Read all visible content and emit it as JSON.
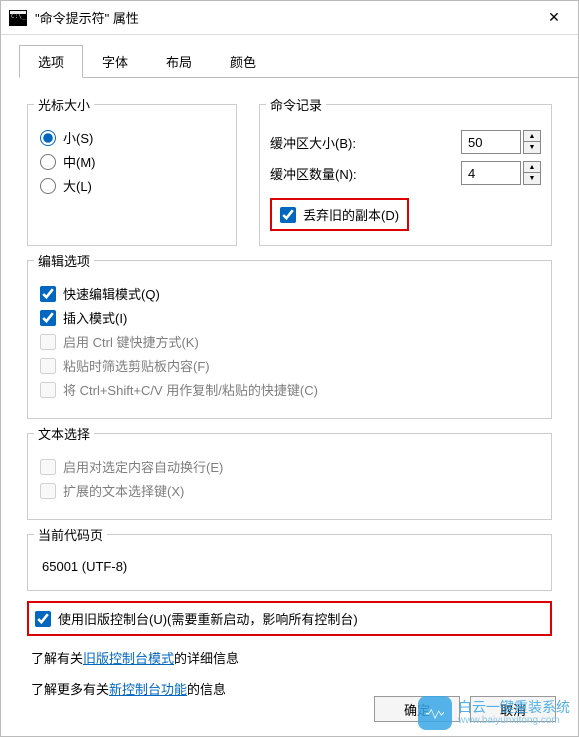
{
  "window": {
    "title": "\"命令提示符\" 属性"
  },
  "tabs": [
    "选项",
    "字体",
    "布局",
    "颜色"
  ],
  "active_tab_index": 0,
  "cursor_size": {
    "legend": "光标大小",
    "options": [
      "小(S)",
      "中(M)",
      "大(L)"
    ],
    "selected_index": 0
  },
  "command_history": {
    "legend": "命令记录",
    "buffer_size_label": "缓冲区大小(B):",
    "buffer_size_value": "50",
    "buffer_count_label": "缓冲区数量(N):",
    "buffer_count_value": "4",
    "discard_old_label": "丢弃旧的副本(D)",
    "discard_old_checked": true
  },
  "edit_options": {
    "legend": "编辑选项",
    "items": [
      {
        "label": "快速编辑模式(Q)",
        "checked": true,
        "enabled": true
      },
      {
        "label": "插入模式(I)",
        "checked": true,
        "enabled": true
      },
      {
        "label": "启用 Ctrl 键快捷方式(K)",
        "checked": false,
        "enabled": false
      },
      {
        "label": "粘贴时筛选剪贴板内容(F)",
        "checked": false,
        "enabled": false
      },
      {
        "label": "将 Ctrl+Shift+C/V 用作复制/粘贴的快捷键(C)",
        "checked": false,
        "enabled": false
      }
    ]
  },
  "text_selection": {
    "legend": "文本选择",
    "items": [
      {
        "label": "启用对选定内容自动换行(E)",
        "checked": false,
        "enabled": false
      },
      {
        "label": "扩展的文本选择键(X)",
        "checked": false,
        "enabled": false
      }
    ]
  },
  "code_page": {
    "legend": "当前代码页",
    "value": "65001 (UTF-8)"
  },
  "legacy_console": {
    "label": "使用旧版控制台(U)(需要重新启动，影响所有控制台)",
    "checked": true
  },
  "info1_pre": "了解有关",
  "info1_link": "旧版控制台模式",
  "info1_post": "的详细信息",
  "info2_pre": "了解更多有关",
  "info2_link": "新控制台功能",
  "info2_post": "的信息",
  "buttons": {
    "ok": "确定",
    "cancel": "取消"
  },
  "watermark": {
    "brand": "白云一键重装系统",
    "url": "www.baiyunxitong.com"
  }
}
